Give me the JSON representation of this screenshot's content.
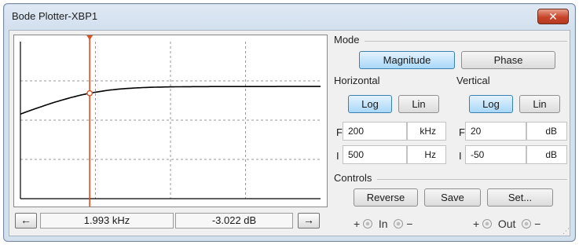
{
  "window": {
    "title": "Bode Plotter-XBP1",
    "close_label": "✕"
  },
  "mode": {
    "label": "Mode",
    "magnitude_label": "Magnitude",
    "phase_label": "Phase",
    "selected": "Magnitude"
  },
  "horizontal": {
    "label": "Horizontal",
    "log_label": "Log",
    "lin_label": "Lin",
    "selected": "Log",
    "f_letter": "F",
    "f_value": "200",
    "f_unit": "kHz",
    "i_letter": "I",
    "i_value": "500",
    "i_unit": "Hz"
  },
  "vertical": {
    "label": "Vertical",
    "log_label": "Log",
    "lin_label": "Lin",
    "selected": "Log",
    "f_letter": "F",
    "f_value": "20",
    "f_unit": "dB",
    "i_letter": "I",
    "i_value": "-50",
    "i_unit": "dB"
  },
  "controls": {
    "label": "Controls",
    "reverse_label": "Reverse",
    "save_label": "Save",
    "set_label": "Set..."
  },
  "readout": {
    "left_arrow": "←",
    "right_arrow": "→",
    "frequency": "1.993 kHz",
    "gain": "-3.022 dB"
  },
  "terminals": {
    "in_plus": "+",
    "in_label": "In",
    "in_minus": "−",
    "out_plus": "+",
    "out_label": "Out",
    "out_minus": "−"
  },
  "plot": {
    "axis_range_x_hz": [
      500,
      200000
    ],
    "axis_range_y_db": [
      -50,
      20
    ],
    "cursor_frequency_hz": 1993,
    "cursor_gain_db": -3.022,
    "grid": true,
    "colors": {
      "trace": "#000000",
      "cursor": "#e0501f",
      "grid": "#9a9a9a"
    }
  }
}
